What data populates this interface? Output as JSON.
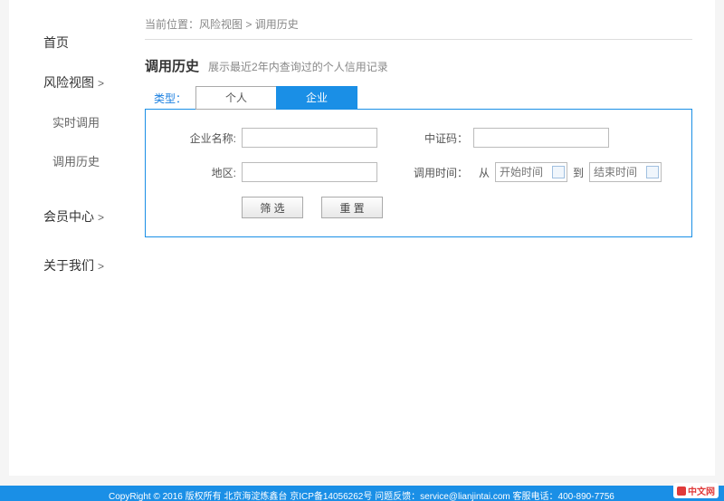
{
  "sidebar": {
    "items": [
      {
        "label": "首页",
        "chevron": ""
      },
      {
        "label": "风险视图",
        "chevron": ">"
      },
      {
        "label": "实时调用",
        "chevron": ""
      },
      {
        "label": "调用历史",
        "chevron": ""
      },
      {
        "label": "会员中心",
        "chevron": ">"
      },
      {
        "label": "关于我们",
        "chevron": ">"
      }
    ]
  },
  "breadcrumb": {
    "prefix": "当前位置：",
    "a": "风险视图",
    "sep": " > ",
    "b": "调用历史"
  },
  "header": {
    "title": "调用历史",
    "subtitle": "展示最近2年内查询过的个人信用记录"
  },
  "type": {
    "label": "类型：",
    "tabs": [
      "个人",
      "企业"
    ],
    "active": 1
  },
  "form": {
    "company_label": "企业名称:",
    "company_value": "",
    "zzcode_label": "中证码：",
    "zzcode_value": "",
    "region_label": "地区:",
    "region_value": "",
    "time_label": "调用时间：",
    "from_label": "从",
    "start_placeholder": "开始时间",
    "to_label": "到",
    "end_placeholder": "结束时间"
  },
  "buttons": {
    "filter": "筛 选",
    "reset": "重 置"
  },
  "footer": {
    "text": "CopyRight © 2016    版权所有    北京海淀炼鑫台    京ICP备14056262号    问题反馈：service@lianjintai.com    客服电话：400-890-7756"
  },
  "badge": {
    "text": "中文网"
  }
}
